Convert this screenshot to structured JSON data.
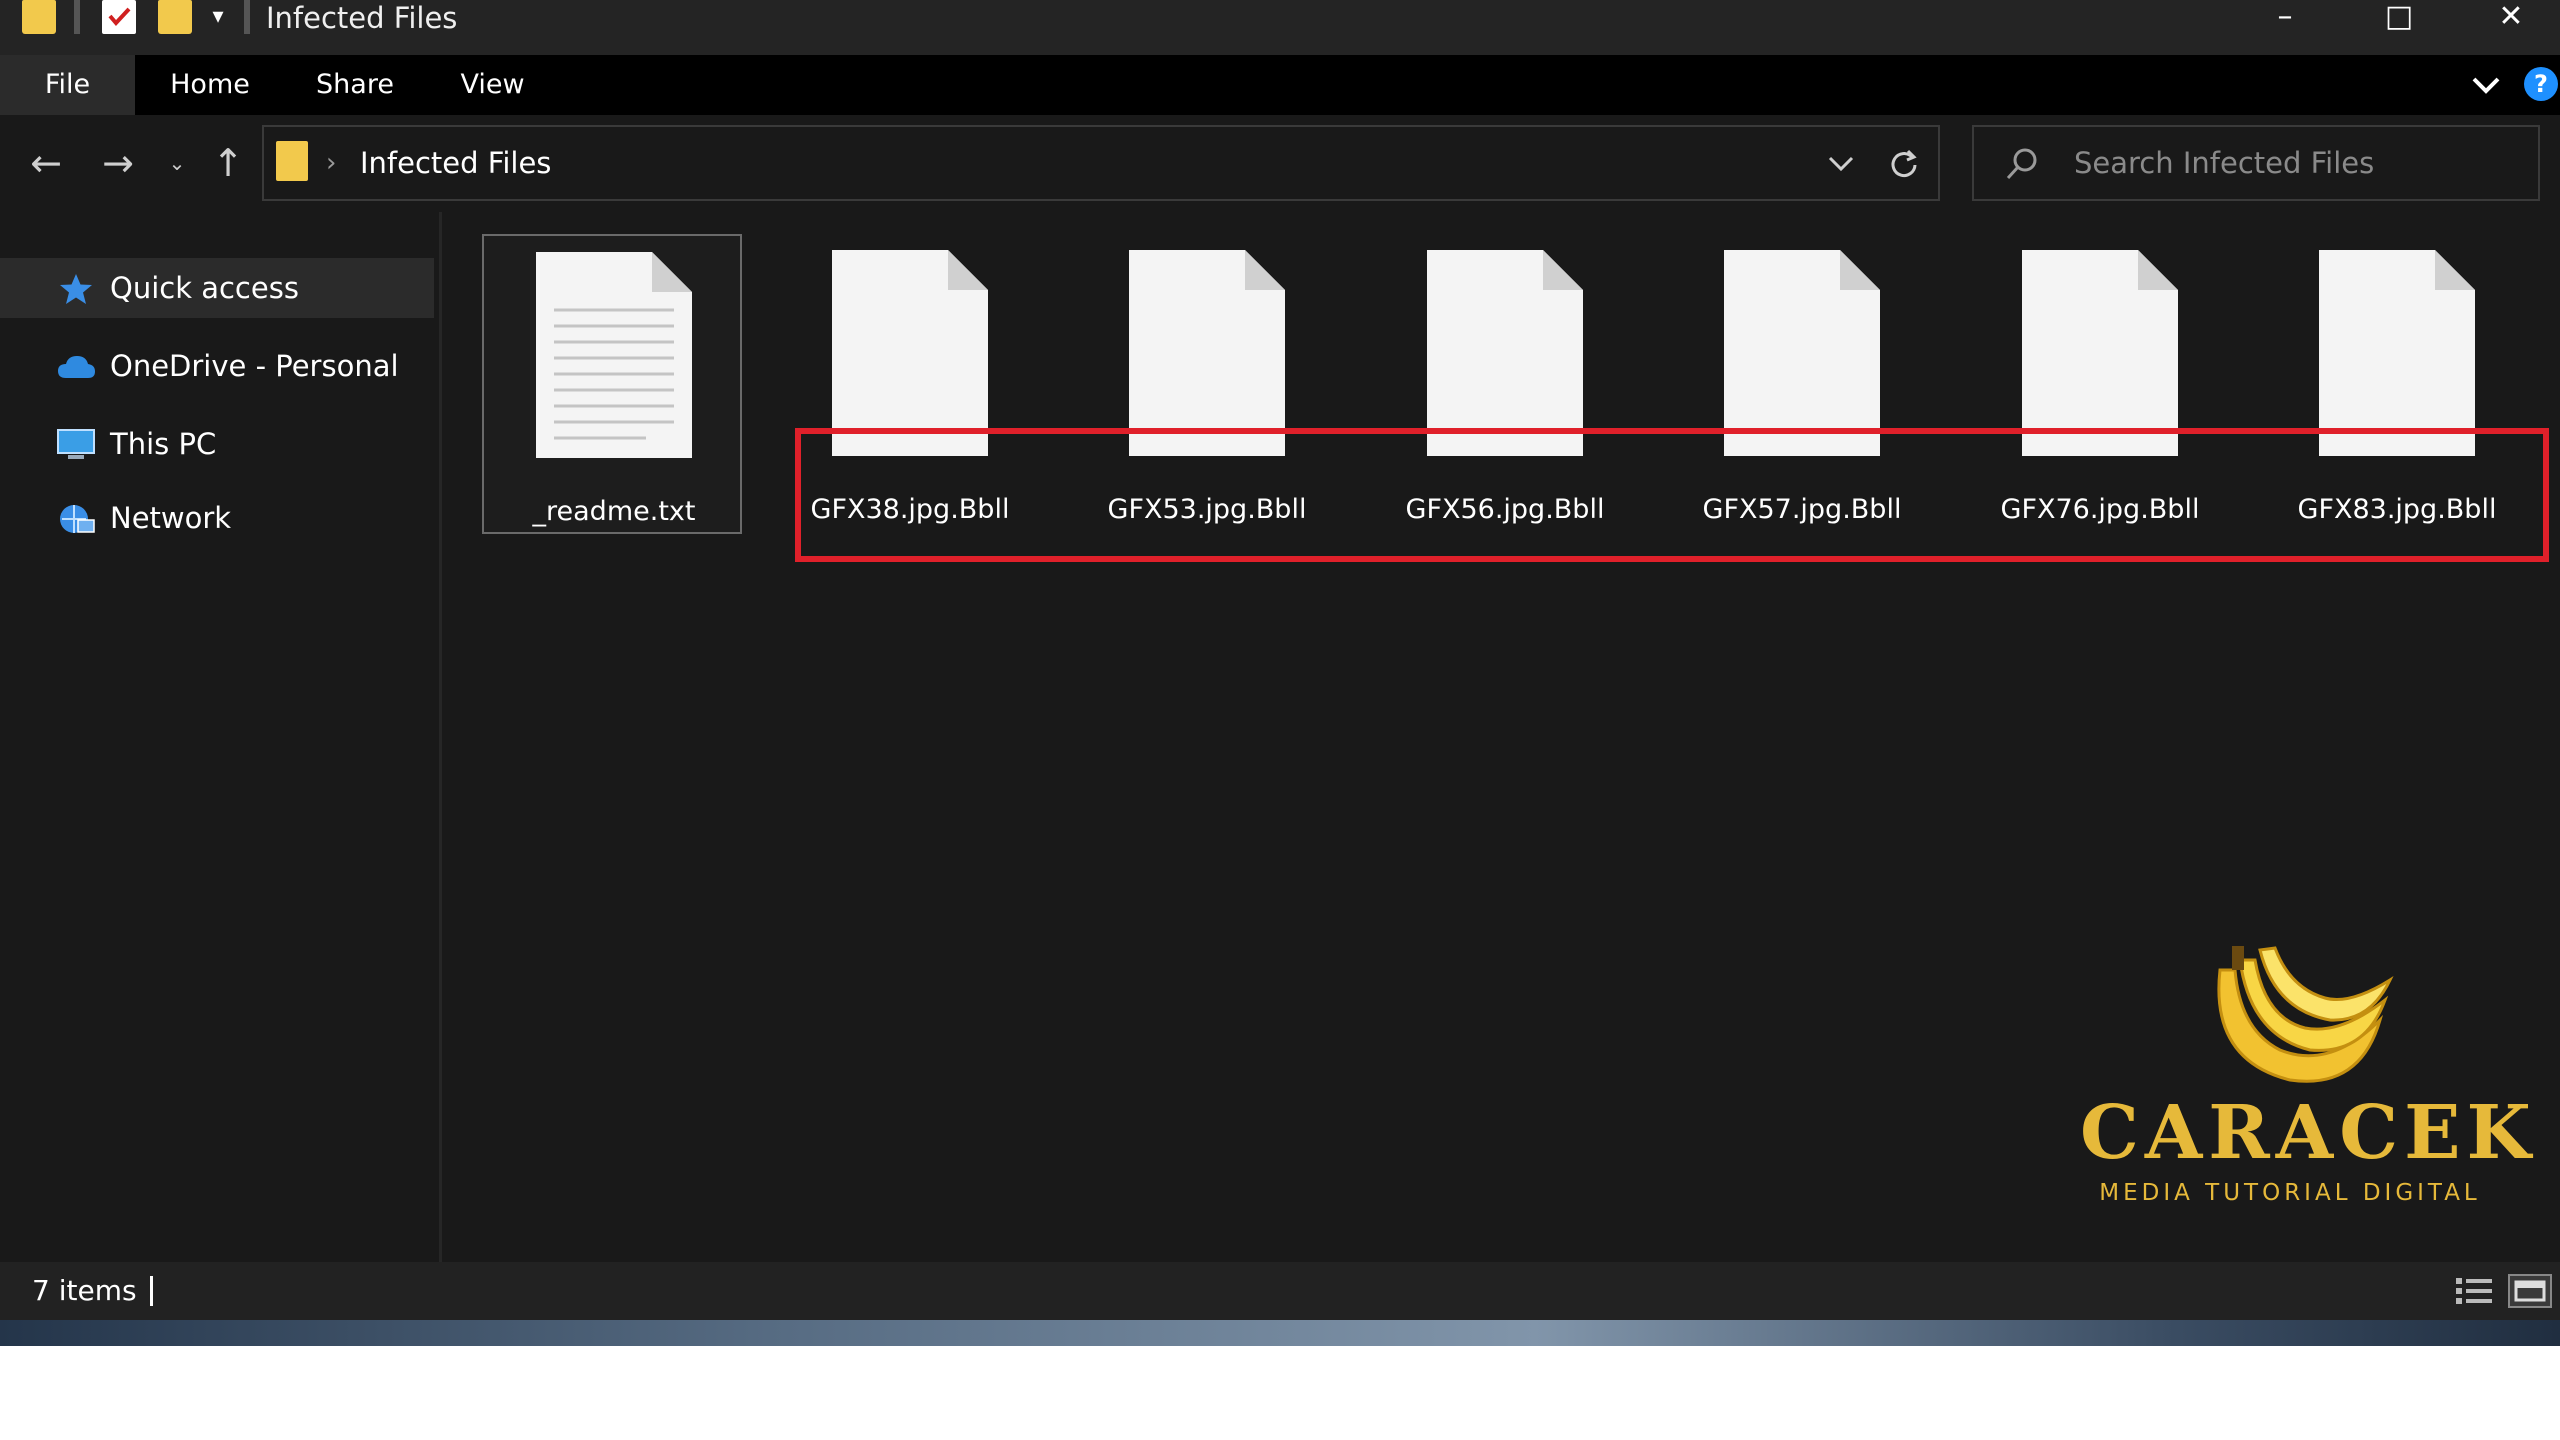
{
  "window": {
    "title": "Infected Files",
    "controls": {
      "minimize": "–",
      "maximize": "□",
      "close": "✕"
    }
  },
  "ribbon": {
    "tabs": [
      {
        "label": "File"
      },
      {
        "label": "Home"
      },
      {
        "label": "Share"
      },
      {
        "label": "View"
      }
    ],
    "help": "?"
  },
  "address": {
    "path": "Infected Files",
    "separator": "›",
    "search_placeholder": "Search Infected Files"
  },
  "sidebar": {
    "items": [
      {
        "label": "Quick access",
        "icon": "star-icon",
        "selected": true
      },
      {
        "label": "OneDrive - Personal",
        "icon": "cloud-icon"
      },
      {
        "label": "This PC",
        "icon": "computer-icon"
      },
      {
        "label": "Network",
        "icon": "network-icon"
      }
    ]
  },
  "files": [
    {
      "name": "_readme.txt",
      "type": "text-document",
      "selected": true
    },
    {
      "name": "GFX38.jpg.Bbll",
      "type": "generic-file"
    },
    {
      "name": "GFX53.jpg.Bbll",
      "type": "generic-file"
    },
    {
      "name": "GFX56.jpg.Bbll",
      "type": "generic-file"
    },
    {
      "name": "GFX57.jpg.Bbll",
      "type": "generic-file"
    },
    {
      "name": "GFX76.jpg.Bbll",
      "type": "generic-file"
    },
    {
      "name": "GFX83.jpg.Bbll",
      "type": "generic-file"
    }
  ],
  "status": {
    "item_count": "7 items"
  },
  "watermark": {
    "brand": "CARACEK",
    "tagline": "MEDIA TUTORIAL DIGITAL"
  },
  "colors": {
    "highlight": "#e0202a",
    "folder": "#f2c94c",
    "accent": "#1e90ff",
    "watermark": "#e6b93a"
  }
}
